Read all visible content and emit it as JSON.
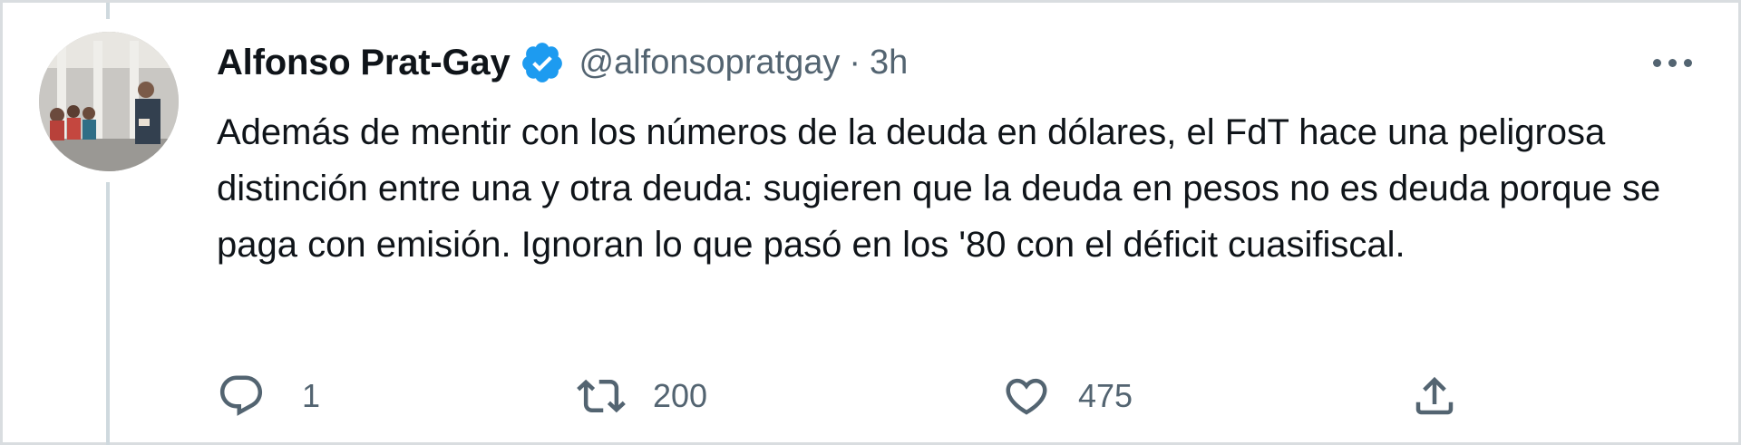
{
  "tweet": {
    "author_name": "Alfonso Prat-Gay",
    "handle": "@alfonsopratgay",
    "separator": "·",
    "time": "3h",
    "verified": true,
    "text": "Además de mentir con los números de la deuda en dólares, el FdT hace una peligrosa distinción entre una y otra deuda: sugieren que la deuda en pesos no es deuda porque se paga con emisión. Ignoran lo que pasó en los '80 con el déficit cuasifiscal."
  },
  "actions": {
    "reply_count": "1",
    "retweet_count": "200",
    "like_count": "475"
  },
  "icons": {
    "verified": "verified-badge-icon",
    "more": "more-options-icon",
    "reply": "reply-icon",
    "retweet": "retweet-icon",
    "like": "heart-icon",
    "share": "share-icon"
  },
  "colors": {
    "text_primary": "#0f1419",
    "text_secondary": "#536471",
    "verified_blue": "#1d9bf0",
    "thread_line": "#cfd9de"
  }
}
